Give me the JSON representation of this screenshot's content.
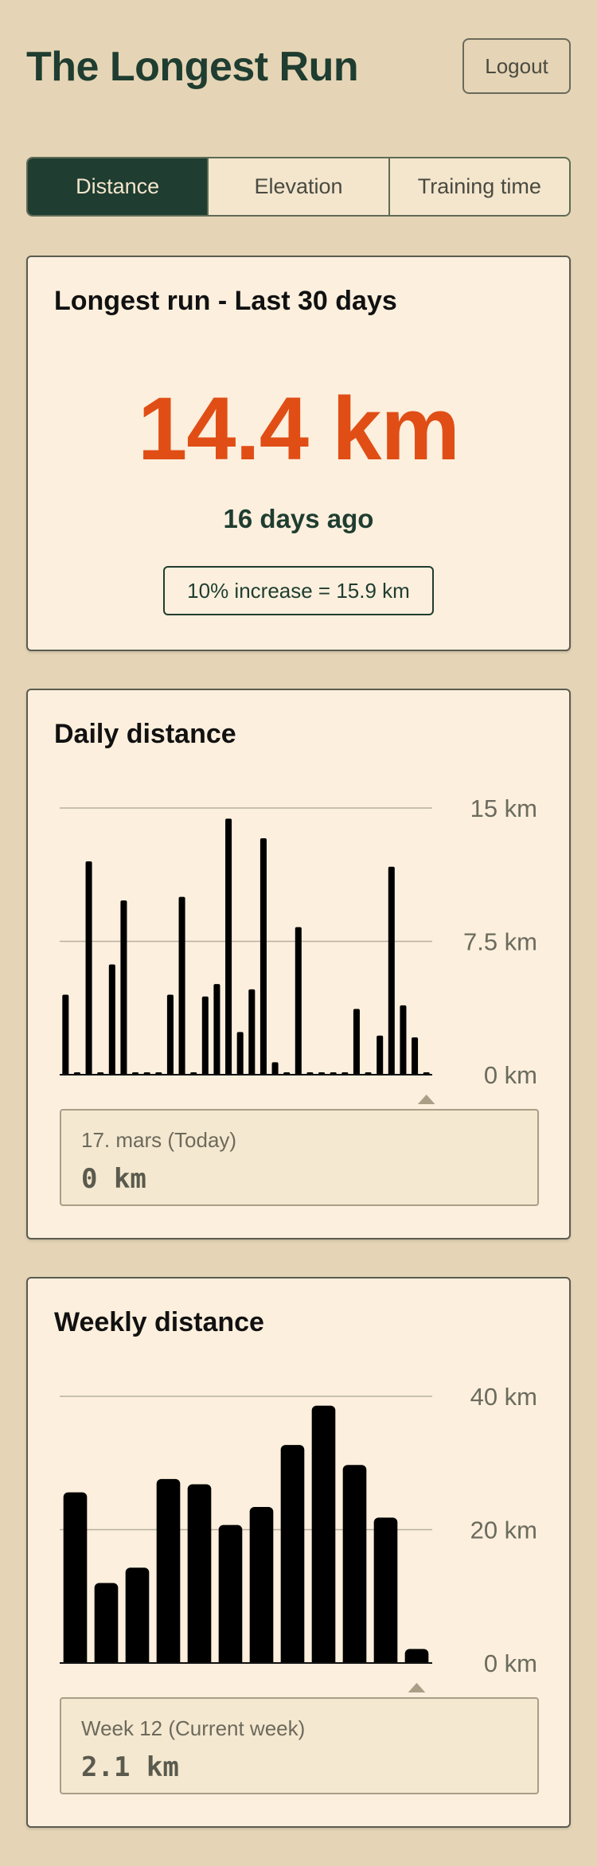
{
  "header": {
    "title": "The Longest Run",
    "logout_label": "Logout"
  },
  "tabs": [
    {
      "label": "Distance",
      "active": true
    },
    {
      "label": "Elevation",
      "active": false
    },
    {
      "label": "Training time",
      "active": false
    }
  ],
  "longest_run": {
    "title": "Longest run - Last 30 days",
    "value": "14.4 km",
    "ago": "16 days ago",
    "increase": "10% increase = 15.9 km"
  },
  "daily": {
    "title": "Daily distance",
    "tooltip_label": "17. mars (Today)",
    "tooltip_value": "0 km"
  },
  "weekly": {
    "title": "Weekly distance",
    "tooltip_label": "Week 12 (Current week)",
    "tooltip_value": "2.1 km"
  },
  "colors": {
    "accent": "#e04e16",
    "brand": "#1f3d30",
    "background": "#e5d5b6",
    "card": "#fcefdd"
  },
  "chart_data": [
    {
      "type": "bar",
      "title": "Daily distance",
      "ylim": [
        0,
        15
      ],
      "y_ticks": [
        "0 km",
        "7.5 km",
        "15 km"
      ],
      "grid": true,
      "values": [
        4.5,
        0,
        12,
        0,
        6.2,
        9.8,
        0,
        0,
        0,
        4.5,
        10,
        0,
        4.4,
        5.1,
        14.4,
        2.4,
        4.8,
        13.3,
        0.7,
        0,
        8.3,
        0,
        0,
        0,
        0,
        3.7,
        0,
        2.2,
        11.7,
        3.9,
        2.1,
        0
      ]
    },
    {
      "type": "bar",
      "title": "Weekly distance",
      "ylim": [
        0,
        40
      ],
      "y_ticks": [
        "0 km",
        "20 km",
        "40 km"
      ],
      "grid": true,
      "values": [
        25.6,
        12,
        14.3,
        27.6,
        26.8,
        20.7,
        23.4,
        32.7,
        38.6,
        29.7,
        21.8,
        2.1
      ]
    }
  ]
}
